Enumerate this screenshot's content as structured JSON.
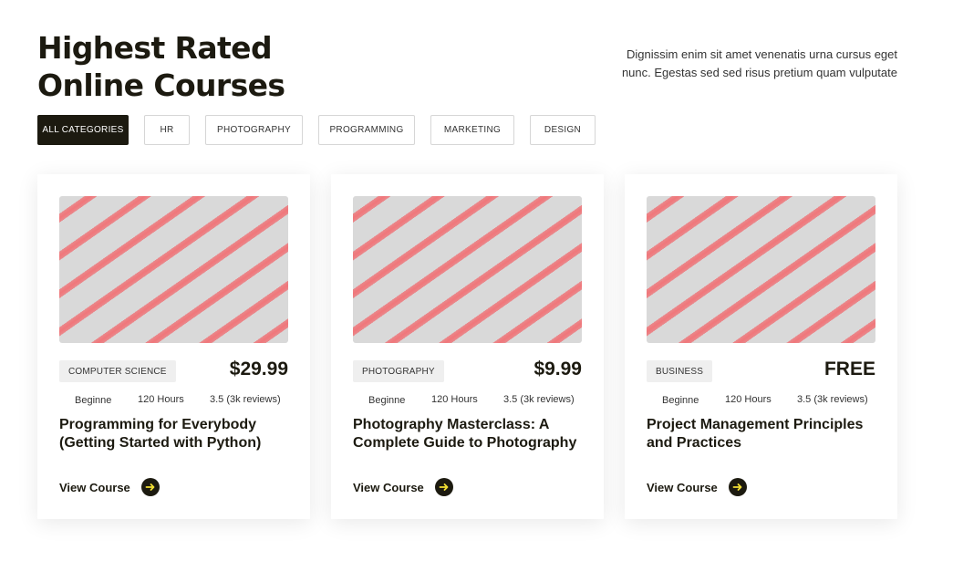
{
  "header": {
    "title": "Highest Rated Online Courses",
    "description": "Dignissim enim sit amet venenatis urna cursus eget nunc. Egestas sed sed risus pretium quam vulputate"
  },
  "filters": [
    {
      "label": "ALL CATEGORIES",
      "active": true
    },
    {
      "label": "HR",
      "active": false
    },
    {
      "label": "PHOTOGRAPHY",
      "active": false
    },
    {
      "label": "PROGRAMMING",
      "active": false
    },
    {
      "label": "MARKETING",
      "active": false
    },
    {
      "label": "DESIGN",
      "active": false
    }
  ],
  "courses": [
    {
      "category": "COMPUTER SCIENCE",
      "price": "$29.99",
      "level": "Beginne",
      "hours": "120 Hours",
      "rating": "3.5 (3k reviews)",
      "title": "Programming for Everybody\n(Getting Started with Python)",
      "cta": "View Course"
    },
    {
      "category": "PHOTOGRAPHY",
      "price": "$9.99",
      "level": "Beginne",
      "hours": "120 Hours",
      "rating": "3.5 (3k reviews)",
      "title": "Photography Masterclass: A\nComplete Guide to Photography",
      "cta": "View Course"
    },
    {
      "category": "BUSINESS",
      "price": "FREE",
      "level": "Beginne",
      "hours": "120 Hours",
      "rating": "3.5 (3k reviews)",
      "title": " Project Management Principles\nand Practices",
      "cta": "View Course"
    }
  ],
  "colors": {
    "dark": "#1c1a10",
    "accent": "#f2e033",
    "badge_bg": "#efefef"
  },
  "icons": {
    "view_course": "arrow-right-circle-icon"
  }
}
